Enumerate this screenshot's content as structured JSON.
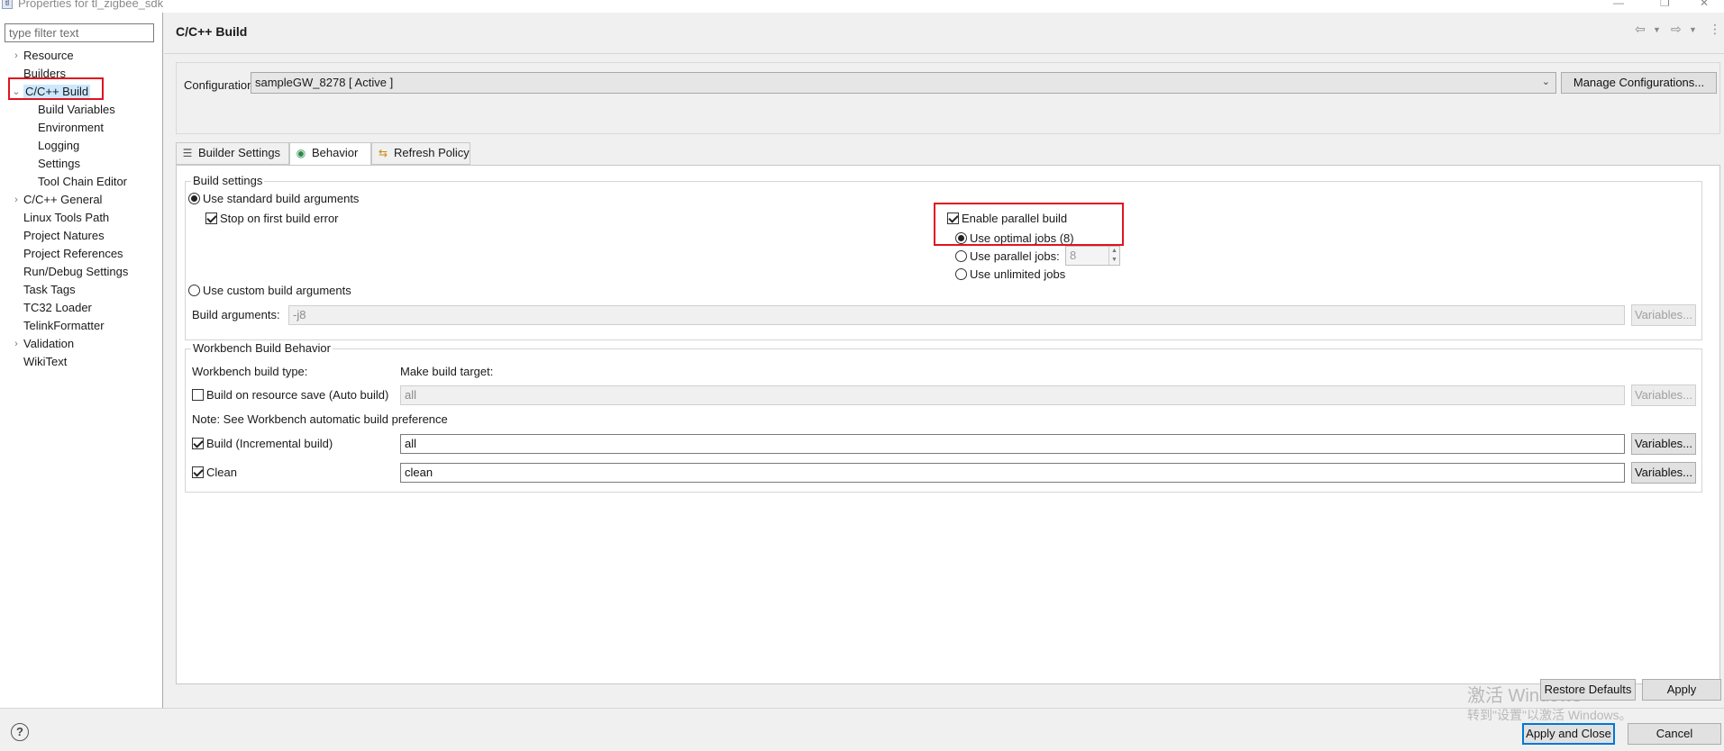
{
  "window": {
    "title": "Properties for tl_zigbee_sdk",
    "icon_glyph": "tl"
  },
  "sidebar": {
    "filter_placeholder": "type filter text",
    "items": [
      {
        "label": "Resource",
        "twisty": "›"
      },
      {
        "label": "Builders",
        "twisty": ""
      },
      {
        "label": "C/C++ Build",
        "twisty": "⌄"
      },
      {
        "label": "Build Variables",
        "twisty": ""
      },
      {
        "label": "Environment",
        "twisty": ""
      },
      {
        "label": "Logging",
        "twisty": ""
      },
      {
        "label": "Settings",
        "twisty": ""
      },
      {
        "label": "Tool Chain Editor",
        "twisty": ""
      },
      {
        "label": "C/C++ General",
        "twisty": "›"
      },
      {
        "label": "Linux Tools Path",
        "twisty": ""
      },
      {
        "label": "Project Natures",
        "twisty": ""
      },
      {
        "label": "Project References",
        "twisty": ""
      },
      {
        "label": "Run/Debug Settings",
        "twisty": ""
      },
      {
        "label": "Task Tags",
        "twisty": ""
      },
      {
        "label": "TC32 Loader",
        "twisty": ""
      },
      {
        "label": "TelinkFormatter",
        "twisty": ""
      },
      {
        "label": "Validation",
        "twisty": "›"
      },
      {
        "label": "WikiText",
        "twisty": ""
      }
    ]
  },
  "header": {
    "title": "C/C++ Build",
    "back_glyph": "⇦",
    "forward_glyph": "⇨",
    "menu_glyph": "⋮"
  },
  "config": {
    "label": "Configuration:",
    "value": "sampleGW_8278  [ Active ]",
    "manage_button": "Manage Configurations..."
  },
  "tabs": [
    {
      "label": "Builder Settings",
      "icon": "builder-settings-icon",
      "glyph": "☰"
    },
    {
      "label": "Behavior",
      "icon": "behavior-icon",
      "glyph": "◉"
    },
    {
      "label": "Refresh Policy",
      "icon": "refresh-policy-icon",
      "glyph": "⇆"
    }
  ],
  "build_settings": {
    "group_title": "Build settings",
    "use_standard": "Use standard build arguments",
    "stop_on_first_error": "Stop on first build error",
    "use_custom": "Use custom build arguments",
    "build_args_label": "Build arguments:",
    "build_args_value": "-j8",
    "variables_button": "Variables...",
    "enable_parallel": "Enable parallel build",
    "use_optimal_jobs": "Use optimal jobs (8)",
    "use_parallel_jobs": "Use parallel jobs:",
    "parallel_jobs_value": "8",
    "use_unlimited_jobs": "Use unlimited jobs"
  },
  "workbench": {
    "group_title": "Workbench Build Behavior",
    "type_label": "Workbench build type:",
    "target_label": "Make build target:",
    "auto_build_label": "Build on resource save (Auto build)",
    "auto_build_value": "all",
    "note": "Note: See Workbench automatic build preference",
    "incremental_label": "Build (Incremental build)",
    "incremental_value": "all",
    "clean_label": "Clean",
    "clean_value": "clean",
    "variables_button": "Variables..."
  },
  "footer": {
    "restore_defaults": "Restore Defaults",
    "apply": "Apply",
    "apply_and_close": "Apply and Close",
    "cancel": "Cancel",
    "help_glyph": "?",
    "watermark_line1": "激活 Windows",
    "watermark_line2": "转到\"设置\"以激活 Windows。"
  },
  "colors": {
    "highlight_red": "#e0141e",
    "primary_blue": "#0078d7"
  }
}
